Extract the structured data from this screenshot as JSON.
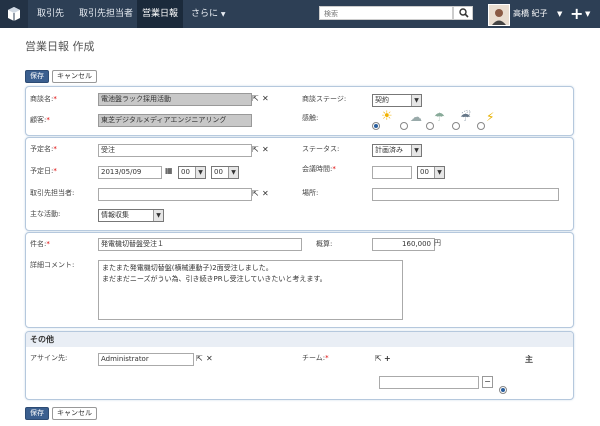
{
  "nav": {
    "tabs": [
      "取引先",
      "取引先担当者",
      "営業日報",
      "さらに"
    ],
    "search_placeholder": "検索",
    "user_name": "高橋 紀子",
    "plus": "+"
  },
  "page_title": "営業日報 作成",
  "buttons": {
    "save": "保存",
    "cancel": "キャンセル"
  },
  "section1": {
    "deal_name_label": "商談名:",
    "deal_name_value": "電池盤ラック採用活動",
    "customer_label": "顧客:",
    "customer_value": "東芝デジタルメディアエンジニアリング",
    "stage_label": "商談ステージ:",
    "stage_value": "契約",
    "feeling_label": "感触:"
  },
  "section2": {
    "plan_name_label": "予定名:",
    "plan_name_value": "受注",
    "plan_date_label": "予定日:",
    "plan_date_value": "2013/05/09",
    "hour_value": "00",
    "minute_value": "00",
    "contact_label": "取引先担当者:",
    "activity_label": "主な活動:",
    "activity_value": "情報収集",
    "status_label": "ステータス:",
    "status_value": "計画済み",
    "meeting_time_label": "会議時間:",
    "meeting_minutes_value": "00",
    "place_label": "場所:"
  },
  "section3": {
    "subject_label": "件名:",
    "subject_value": "発電機切替盤受注１",
    "estimate_label": "概算:",
    "estimate_value": "160,000",
    "currency": "円",
    "detail_label": "詳細コメント:",
    "detail_lines": [
      "またまた発電機切替盤(横械連動子)2面受注しました。",
      "まだまだニーズがうい為、引き続きPRし受注していきたいと考えます。"
    ]
  },
  "section4": {
    "header": "その他",
    "assign_label": "アサイン先:",
    "assign_value": "Administrator",
    "team_label": "チーム:",
    "primary_label": "主"
  }
}
